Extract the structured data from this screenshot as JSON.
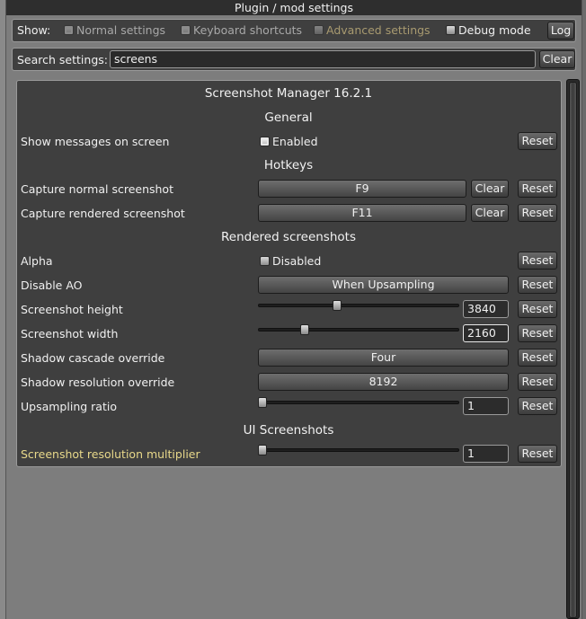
{
  "window": {
    "title": "Plugin / mod settings"
  },
  "show_bar": {
    "label": "Show:",
    "normal": "Normal settings",
    "keyboard": "Keyboard shortcuts",
    "advanced": "Advanced settings",
    "debug": "Debug mode",
    "log": "Log"
  },
  "search": {
    "label": "Search settings:",
    "value": "screens",
    "clear": "Clear"
  },
  "plugin": {
    "title": "Screenshot Manager 16.2.1",
    "sections": {
      "general": "General",
      "hotkeys": "Hotkeys",
      "rendered": "Rendered screenshots",
      "ui": "UI Screenshots"
    },
    "rows": {
      "show_messages": {
        "label": "Show messages on screen",
        "value": "Enabled",
        "checked": true
      },
      "capture_normal": {
        "label": "Capture normal screenshot",
        "value": "F9"
      },
      "capture_rendered": {
        "label": "Capture rendered screenshot",
        "value": "F11"
      },
      "alpha": {
        "label": "Alpha",
        "value": "Disabled",
        "checked": false
      },
      "disable_ao": {
        "label": "Disable AO",
        "value": "When Upsampling"
      },
      "height": {
        "label": "Screenshot height",
        "value": "3840",
        "level": 0.39
      },
      "width": {
        "label": "Screenshot width",
        "value": "2160",
        "level": 0.22
      },
      "shadow_cascade": {
        "label": "Shadow cascade override",
        "value": "Four"
      },
      "shadow_resolution": {
        "label": "Shadow resolution override",
        "value": "8192"
      },
      "upsampling": {
        "label": "Upsampling ratio",
        "value": "1",
        "level": 0.0
      },
      "ui_multiplier": {
        "label": "Screenshot resolution multiplier",
        "value": "1",
        "level": 0.0
      }
    },
    "reset": "Reset",
    "clear": "Clear"
  },
  "colors": {
    "highlight_label": "#e8d88a",
    "dim_text": "#a8a8a8",
    "advanced_text": "#a89a70"
  }
}
